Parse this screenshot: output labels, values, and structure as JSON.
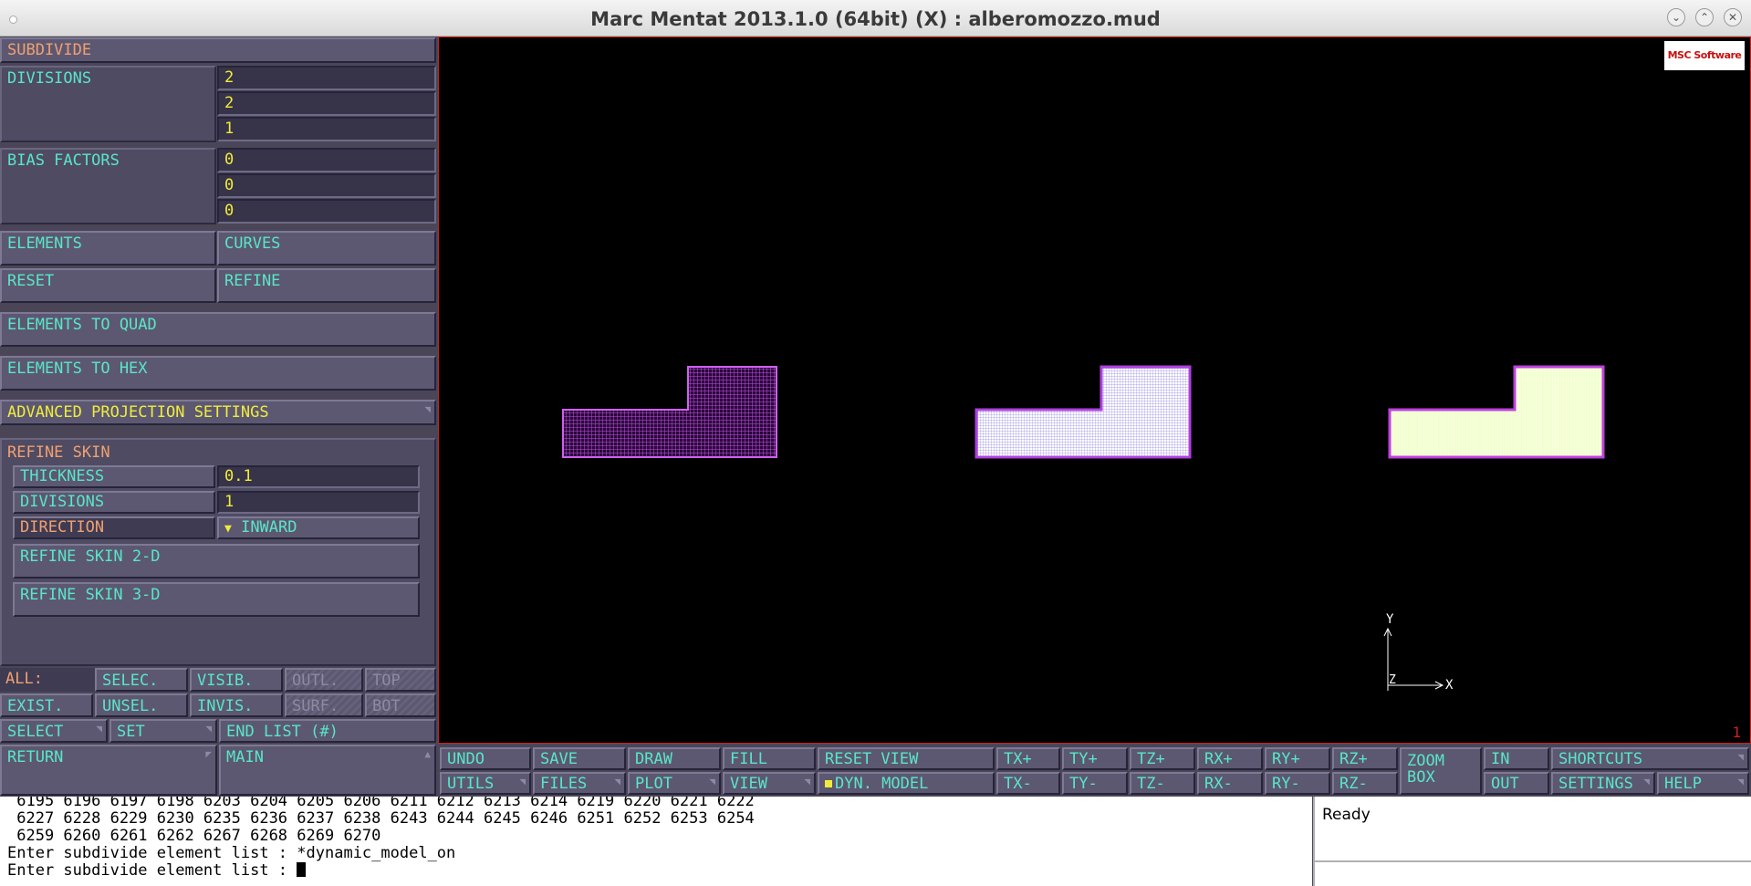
{
  "window": {
    "title": "Marc Mentat 2013.1.0 (64bit) (X) : alberomozzo.mud",
    "controls": {
      "minimize": "⌄",
      "maximize": "⌃",
      "close": "✕"
    }
  },
  "panel": {
    "header": "SUBDIVIDE",
    "divisions_label": "DIVISIONS",
    "divisions": [
      "2",
      "2",
      "1"
    ],
    "bias_label": "BIAS FACTORS",
    "bias": [
      "0",
      "0",
      "0"
    ],
    "elements": "ELEMENTS",
    "curves": "CURVES",
    "reset": "RESET",
    "refine": "REFINE",
    "elements_to_quad": "ELEMENTS TO QUAD",
    "elements_to_hex": "ELEMENTS TO HEX",
    "advanced_projection": "ADVANCED PROJECTION SETTINGS",
    "refine_skin": {
      "header": "REFINE SKIN",
      "thickness_label": "THICKNESS",
      "thickness": "0.1",
      "divisions_label": "DIVISIONS",
      "divisions": "1",
      "direction_label": "DIRECTION",
      "direction": "INWARD",
      "skin_2d": "REFINE SKIN 2-D",
      "skin_3d": "REFINE SKIN 3-D"
    }
  },
  "selection": {
    "all": "ALL:",
    "exist": "EXIST.",
    "selec": "SELEC.",
    "unsel": "UNSEL.",
    "visib": "VISIB.",
    "invis": "INVIS.",
    "outl": "OUTL.",
    "surf": "SURF.",
    "top": "TOP",
    "bot": "BOT",
    "select": "SELECT",
    "set": "SET",
    "end_list": "END LIST (#)",
    "return": "RETURN",
    "main": "MAIN"
  },
  "toolbar": {
    "undo": "UNDO",
    "save": "SAVE",
    "draw": "DRAW",
    "fill": "FILL",
    "reset_view": "RESET VIEW",
    "tx_plus": "TX+",
    "ty_plus": "TY+",
    "tz_plus": "TZ+",
    "rx_plus": "RX+",
    "ry_plus": "RY+",
    "rz_plus": "RZ+",
    "zoom_box_1": "ZOOM",
    "zoom_box_2": "BOX",
    "in": "IN",
    "shortcuts": "SHORTCUTS",
    "utils": "UTILS",
    "files": "FILES",
    "plot": "PLOT",
    "view": "VIEW",
    "dyn_model": "DYN. MODEL",
    "tx_minus": "TX-",
    "ty_minus": "TY-",
    "tz_minus": "TZ-",
    "rx_minus": "RX-",
    "ry_minus": "RY-",
    "rz_minus": "RZ-",
    "out": "OUT",
    "settings": "SETTINGS",
    "help": "HELP"
  },
  "viewport": {
    "logo": "MSC Software",
    "number": "1",
    "axis_y": "Y",
    "axis_x": "X",
    "axis_z": "Z",
    "colors": {
      "mesh1": "#c050e8",
      "mesh2": "#f0ecff",
      "mesh3": "#f2ffd0"
    }
  },
  "console": {
    "lines": [
      " 6195 6196 6197 6198 6203 6204 6205 6206 6211 6212 6213 6214 6219 6220 6221 6222",
      " 6227 6228 6229 6230 6235 6236 6237 6238 6243 6244 6245 6246 6251 6252 6253 6254",
      " 6259 6260 6261 6262 6267 6268 6269 6270",
      "Enter subdivide element list : *dynamic_model_on",
      "Enter subdivide element list : "
    ]
  },
  "status": {
    "text": "Ready"
  }
}
